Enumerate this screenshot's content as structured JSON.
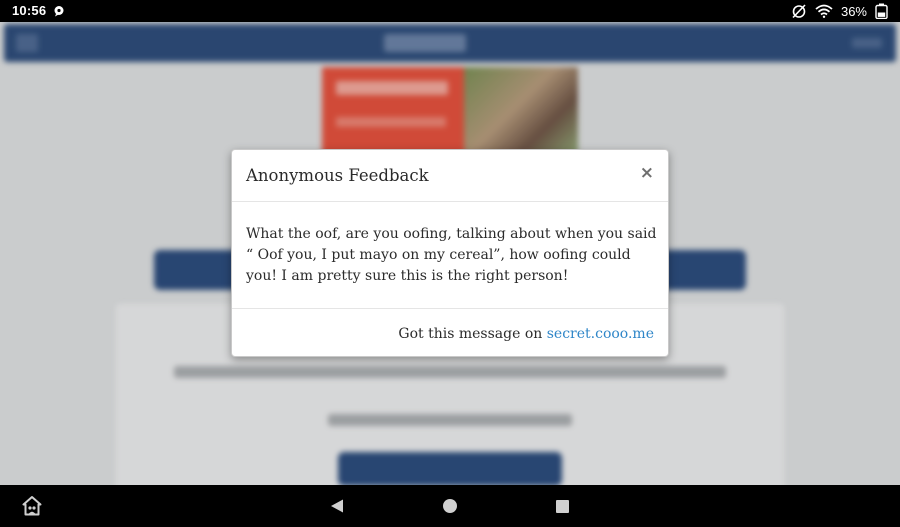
{
  "status_bar": {
    "time": "10:56",
    "battery": "36%",
    "icons": [
      "notification-bubble-icon",
      "alarm-off-icon",
      "wifi-icon",
      "battery-icon"
    ]
  },
  "modal": {
    "title": "Anonymous Feedback",
    "close_label": "×",
    "message": "What the oof, are you oofing, talking about when you said “ Oof you, I put mayo on my cereal”, how oofing could you! I am pretty sure this is the right person!",
    "footer_prefix": "Got this message on",
    "footer_link": "secret.cooo.me",
    "link_color": "#2f86c8"
  },
  "nav_bar": {
    "icons": [
      "home-icon",
      "back-icon",
      "home-circle-icon",
      "recents-icon"
    ]
  }
}
